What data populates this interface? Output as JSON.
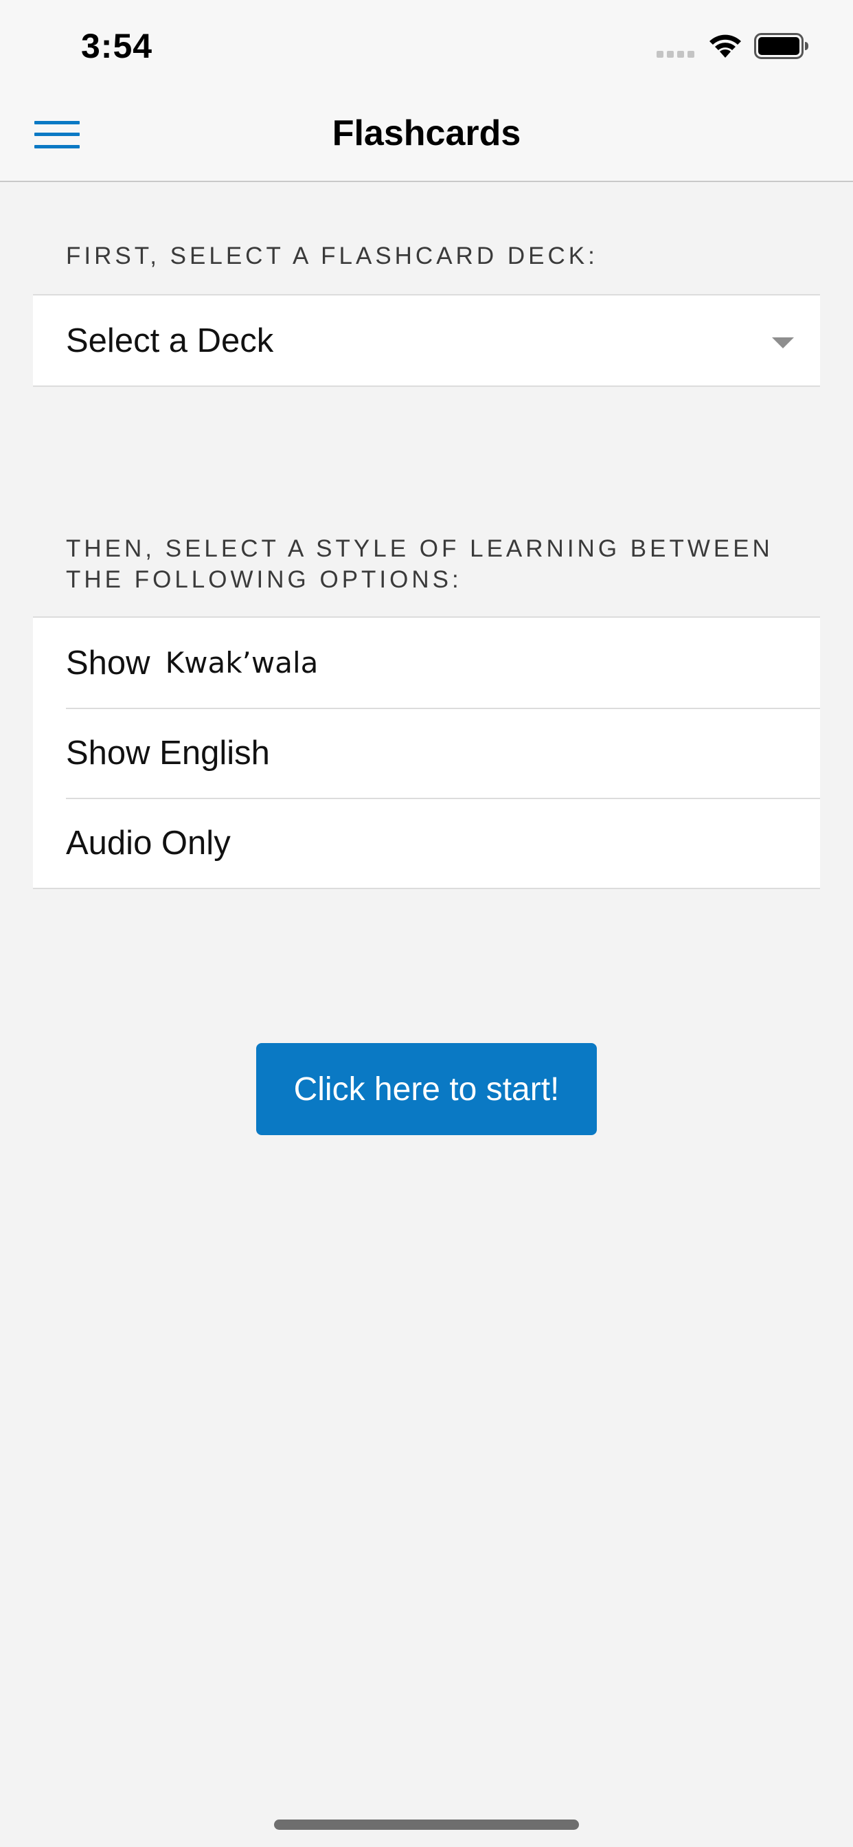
{
  "status_bar": {
    "time": "3:54"
  },
  "nav": {
    "title": "Flashcards"
  },
  "deck_section": {
    "header": "FIRST, SELECT A FLASHCARD DECK:",
    "selected_value": "Select a Deck"
  },
  "style_section": {
    "header": "THEN, SELECT A STYLE OF LEARNING BETWEEN THE FOLLOWING OPTIONS:",
    "options": [
      {
        "label": "Show",
        "secondary": "Kwak’wala"
      },
      {
        "label": "Show English"
      },
      {
        "label": "Audio Only"
      }
    ]
  },
  "start_button": {
    "label": "Click here to start!"
  },
  "colors": {
    "accent": "#0a79c4",
    "background": "#f3f3f3",
    "bar_background": "#f7f7f7"
  },
  "icons": {
    "menu": "menu-icon",
    "dropdown": "caret-down-icon",
    "wifi": "wifi-icon",
    "battery": "battery-icon"
  }
}
